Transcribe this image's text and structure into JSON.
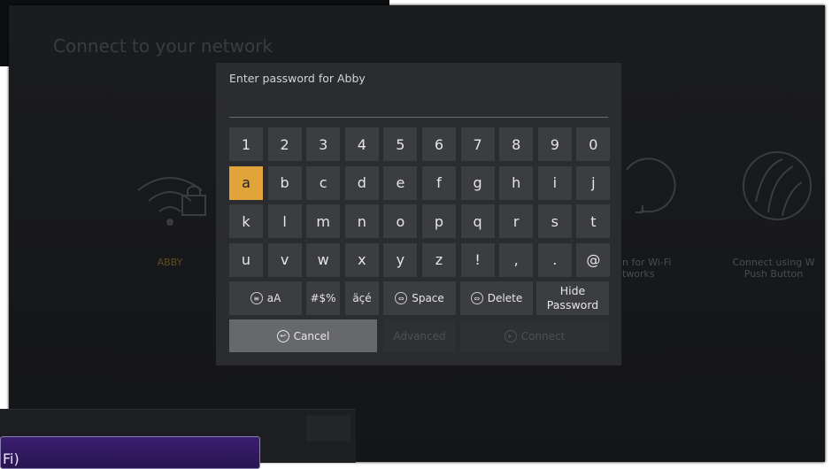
{
  "screen": {
    "title": "Connect to your network"
  },
  "networks": [
    {
      "label": "ABBY",
      "icon": "wifi-lock-icon"
    },
    {
      "label": "n for Wi-Fi\ntworks",
      "icon": "rescan-icon"
    },
    {
      "label": "Connect using W\nPush Button",
      "icon": "wps-icon"
    }
  ],
  "dialog": {
    "title": "Enter password for Abby",
    "password_value": "",
    "keyboard": {
      "rows": [
        [
          "1",
          "2",
          "3",
          "4",
          "5",
          "6",
          "7",
          "8",
          "9",
          "0"
        ],
        [
          "a",
          "b",
          "c",
          "d",
          "e",
          "f",
          "g",
          "h",
          "i",
          "j"
        ],
        [
          "k",
          "l",
          "m",
          "n",
          "o",
          "p",
          "q",
          "r",
          "s",
          "t"
        ],
        [
          "u",
          "v",
          "w",
          "x",
          "y",
          "z",
          "!",
          ",",
          ".",
          "@"
        ]
      ],
      "selected_key": "a",
      "function_keys": {
        "case_toggle": "aA",
        "symbols": "#$%",
        "accents": "äçé",
        "space": "Space",
        "delete": "Delete",
        "hide_password": "Hide Password"
      }
    },
    "buttons": {
      "cancel": "Cancel",
      "advanced": "Advanced",
      "connect": "Connect"
    }
  },
  "background_photo": {
    "overlay_text": "Fi)"
  },
  "colors": {
    "selected_key": "#e0a43b",
    "network_label": "#b8862e"
  }
}
